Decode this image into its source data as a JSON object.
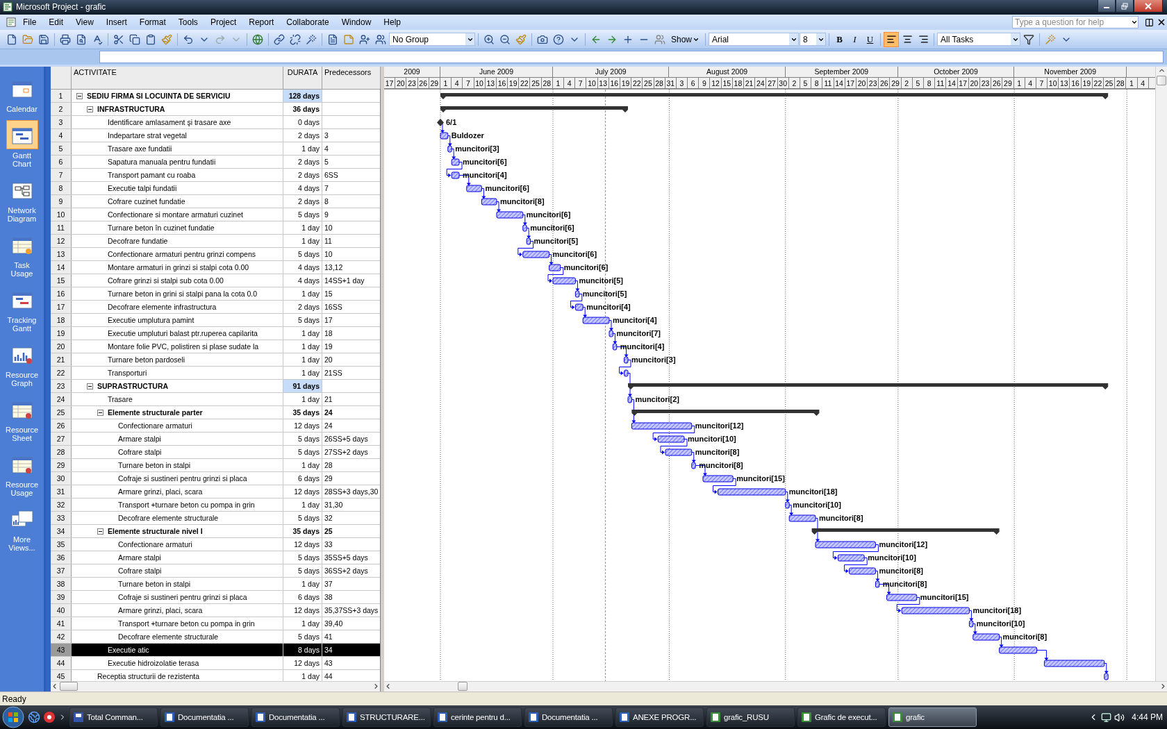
{
  "window": {
    "title": "Microsoft Project - grafic"
  },
  "menu": [
    "File",
    "Edit",
    "View",
    "Insert",
    "Format",
    "Tools",
    "Project",
    "Report",
    "Collaborate",
    "Window",
    "Help"
  ],
  "help_box": {
    "placeholder": "Type a question for help"
  },
  "toolbar": {
    "group": "No Group",
    "show": "Show",
    "font": "Arial",
    "size": "8",
    "format_buttons": [
      "B",
      "I",
      "U"
    ],
    "align": [
      {
        "kind": "left",
        "selected": true
      },
      {
        "kind": "center",
        "selected": false
      },
      {
        "kind": "right",
        "selected": false
      }
    ],
    "filter": "All Tasks"
  },
  "view_bar": [
    {
      "kind": "calendar",
      "label": "Calendar",
      "selected": false
    },
    {
      "kind": "gantt",
      "label": "Gantt Chart",
      "selected": true
    },
    {
      "kind": "network",
      "label": "Network Diagram",
      "selected": false
    },
    {
      "kind": "task_usage",
      "label": "Task Usage",
      "selected": false
    },
    {
      "kind": "tracking",
      "label": "Tracking Gantt",
      "selected": false
    },
    {
      "kind": "graph",
      "label": "Resource Graph",
      "selected": false
    },
    {
      "kind": "sheet",
      "label": "Resource Sheet",
      "selected": false
    },
    {
      "kind": "resource_usage",
      "label": "Resource Usage",
      "selected": false
    },
    {
      "kind": "more",
      "label": "More Views...",
      "selected": false
    }
  ],
  "table": {
    "columns": [
      "ACTIVITATE",
      "DURATA",
      "Predecessors"
    ],
    "tasks": [
      {
        "id": "1",
        "name": "SEDIU FIRMA SI LOCUINTA DE SERVICIU",
        "duration": "128 days",
        "kind": "summary",
        "expanded": true,
        "selected": false,
        "duration_highlighted": true,
        "children": [
          {
            "id": "2",
            "name": "INFRASTRUCTURA",
            "duration": "36 days",
            "kind": "summary",
            "expanded": true,
            "selected": false,
            "duration_highlighted": false,
            "children": [
              {
                "id": "3",
                "name": "Identificare amlasament şi trasare axe",
                "duration": "0 days",
                "kind": "milestone",
                "selected": false,
                "duration_highlighted": false,
                "bar_label": "6/1"
              },
              {
                "id": "4",
                "name": "Indepartare strat vegetal",
                "duration": "2 days",
                "predecessors": "3",
                "kind": "task",
                "selected": false,
                "duration_highlighted": false,
                "bar_label": "Buldozer"
              },
              {
                "id": "5",
                "name": "Trasare axe fundatii",
                "duration": "1 day",
                "predecessors": "4",
                "kind": "task",
                "selected": false,
                "duration_highlighted": false,
                "bar_label": "muncitori[3]"
              },
              {
                "id": "6",
                "name": "Sapatura manuala pentru fundatii",
                "duration": "2 days",
                "predecessors": "5",
                "kind": "task",
                "selected": false,
                "duration_highlighted": false,
                "bar_label": "muncitori[6]"
              },
              {
                "id": "7",
                "name": "Transport pamant cu roaba",
                "duration": "2 days",
                "predecessors": "6SS",
                "kind": "task",
                "selected": false,
                "duration_highlighted": false,
                "bar_label": "muncitori[4]"
              },
              {
                "id": "8",
                "name": "Executie talpi fundatii",
                "duration": "4 days",
                "predecessors": "7",
                "kind": "task",
                "selected": false,
                "duration_highlighted": false,
                "bar_label": "muncitori[6]"
              },
              {
                "id": "9",
                "name": "Cofrare cuzinet fundatie",
                "duration": "2 days",
                "predecessors": "8",
                "kind": "task",
                "selected": false,
                "duration_highlighted": false,
                "bar_label": "muncitori[8]"
              },
              {
                "id": "10",
                "name": "Confectionare si montare armaturi cuzinet",
                "duration": "5 days",
                "predecessors": "9",
                "kind": "task",
                "selected": false,
                "duration_highlighted": false,
                "bar_label": "muncitori[6]"
              },
              {
                "id": "11",
                "name": "Turnare beton în cuzinet fundatie",
                "duration": "1 day",
                "predecessors": "10",
                "kind": "task",
                "selected": false,
                "duration_highlighted": false,
                "bar_label": "muncitori[6]"
              },
              {
                "id": "12",
                "name": "Decofrare fundatie",
                "duration": "1 day",
                "predecessors": "11",
                "kind": "task",
                "selected": false,
                "duration_highlighted": false,
                "bar_label": "muncitori[5]"
              },
              {
                "id": "13",
                "name": "Confectionare armaturi pentru grinzi compens",
                "duration": "5 days",
                "predecessors": "10",
                "kind": "task",
                "selected": false,
                "duration_highlighted": false,
                "bar_label": "muncitori[6]"
              },
              {
                "id": "14",
                "name": "Montare armaturi in grinzi si stalpi cota 0.00",
                "duration": "4 days",
                "predecessors": "13,12",
                "kind": "task",
                "selected": false,
                "duration_highlighted": false,
                "bar_label": "muncitori[6]"
              },
              {
                "id": "15",
                "name": "Cofrare grinzi si stalpi sub cota 0.00",
                "duration": "4 days",
                "predecessors": "14SS+1 day",
                "kind": "task",
                "selected": false,
                "duration_highlighted": false,
                "bar_label": "muncitori[5]"
              },
              {
                "id": "16",
                "name": "Turnare beton in grini si stalpi pana la cota 0.0",
                "duration": "1 day",
                "predecessors": "15",
                "kind": "task",
                "selected": false,
                "duration_highlighted": false,
                "bar_label": "muncitori[5]"
              },
              {
                "id": "17",
                "name": "Decofrare elemente infrastructura",
                "duration": "2 days",
                "predecessors": "16SS",
                "kind": "task",
                "selected": false,
                "duration_highlighted": false,
                "bar_label": "muncitori[4]"
              },
              {
                "id": "18",
                "name": "Executie umplutura pamint",
                "duration": "5 days",
                "predecessors": "17",
                "kind": "task",
                "selected": false,
                "duration_highlighted": false,
                "bar_label": "muncitori[4]"
              },
              {
                "id": "19",
                "name": "Executie umpluturi balast ptr.ruperea capilarita",
                "duration": "1 day",
                "predecessors": "18",
                "kind": "task",
                "selected": false,
                "duration_highlighted": false,
                "bar_label": "muncitori[7]"
              },
              {
                "id": "20",
                "name": "Montare folie PVC, polistiren si plase sudate la",
                "duration": "1 day",
                "predecessors": "19",
                "kind": "task",
                "selected": false,
                "duration_highlighted": false,
                "bar_label": "muncitori[4]"
              },
              {
                "id": "21",
                "name": "Turnare beton pardoseli",
                "duration": "1 day",
                "predecessors": "20",
                "kind": "task",
                "selected": false,
                "duration_highlighted": false,
                "bar_label": "muncitori[3]"
              },
              {
                "id": "22",
                "name": "Transporturi",
                "duration": "1 day",
                "predecessors": "21SS",
                "kind": "task",
                "selected": false,
                "duration_highlighted": false
              }
            ]
          },
          {
            "id": "23",
            "name": "SUPRASTRUCTURA",
            "duration": "91 days",
            "kind": "summary",
            "expanded": true,
            "selected": false,
            "duration_highlighted": true,
            "children": [
              {
                "id": "24",
                "name": "Trasare",
                "duration": "1 day",
                "predecessors": "21",
                "kind": "task",
                "selected": false,
                "duration_highlighted": false,
                "bar_label": "muncitori[2]"
              },
              {
                "id": "25",
                "name": "Elemente structurale parter",
                "duration": "35 days",
                "predecessors": "24",
                "kind": "summary",
                "expanded": true,
                "selected": false,
                "duration_highlighted": false,
                "children": [
                  {
                    "id": "26",
                    "name": "Confectionare armaturi",
                    "duration": "12 days",
                    "predecessors": "24",
                    "kind": "task",
                    "selected": false,
                    "duration_highlighted": false,
                    "bar_label": "muncitori[12]"
                  },
                  {
                    "id": "27",
                    "name": "Armare stalpi",
                    "duration": "5 days",
                    "predecessors": "26SS+5 days",
                    "kind": "task",
                    "selected": false,
                    "duration_highlighted": false,
                    "bar_label": "muncitori[10]"
                  },
                  {
                    "id": "28",
                    "name": "Cofrare stalpi",
                    "duration": "5 days",
                    "predecessors": "27SS+2 days",
                    "kind": "task",
                    "selected": false,
                    "duration_highlighted": false,
                    "bar_label": "muncitori[8]"
                  },
                  {
                    "id": "29",
                    "name": "Turnare beton in stalpi",
                    "duration": "1 day",
                    "predecessors": "28",
                    "kind": "task",
                    "selected": false,
                    "duration_highlighted": false,
                    "bar_label": "muncitori[8]"
                  },
                  {
                    "id": "30",
                    "name": "Cofraje si sustineri pentru grinzi si placa",
                    "duration": "6 days",
                    "predecessors": "29",
                    "kind": "task",
                    "selected": false,
                    "duration_highlighted": false,
                    "bar_label": "muncitori[15]"
                  },
                  {
                    "id": "31",
                    "name": "Armare grinzi, placi, scara",
                    "duration": "12 days",
                    "predecessors": "28SS+3 days,30",
                    "kind": "task",
                    "selected": false,
                    "duration_highlighted": false,
                    "bar_label": "muncitori[18]"
                  },
                  {
                    "id": "32",
                    "name": "Transport +turnare beton cu pompa in grin",
                    "duration": "1 day",
                    "predecessors": "31,30",
                    "kind": "task",
                    "selected": false,
                    "duration_highlighted": false,
                    "bar_label": "muncitori[10]"
                  },
                  {
                    "id": "33",
                    "name": "Decofrare elemente structurale",
                    "duration": "5 days",
                    "predecessors": "32",
                    "kind": "task",
                    "selected": false,
                    "duration_highlighted": false,
                    "bar_label": "muncitori[8]"
                  }
                ]
              },
              {
                "id": "34",
                "name": "Elemente structurale nivel I",
                "duration": "35 days",
                "predecessors": "25",
                "kind": "summary",
                "expanded": true,
                "selected": false,
                "duration_highlighted": false,
                "children": [
                  {
                    "id": "35",
                    "name": "Confectionare armaturi",
                    "duration": "12 days",
                    "predecessors": "33",
                    "kind": "task",
                    "selected": false,
                    "duration_highlighted": false,
                    "bar_label": "muncitori[12]"
                  },
                  {
                    "id": "36",
                    "name": "Armare stalpi",
                    "duration": "5 days",
                    "predecessors": "35SS+5 days",
                    "kind": "task",
                    "selected": false,
                    "duration_highlighted": false,
                    "bar_label": "muncitori[10]"
                  },
                  {
                    "id": "37",
                    "name": "Cofrare stalpi",
                    "duration": "5 days",
                    "predecessors": "36SS+2 days",
                    "kind": "task",
                    "selected": false,
                    "duration_highlighted": false,
                    "bar_label": "muncitori[8]"
                  },
                  {
                    "id": "38",
                    "name": "Turnare beton in stalpi",
                    "duration": "1 day",
                    "predecessors": "37",
                    "kind": "task",
                    "selected": false,
                    "duration_highlighted": false,
                    "bar_label": "muncitori[8]"
                  },
                  {
                    "id": "39",
                    "name": "Cofraje si sustineri pentru grinzi si placa",
                    "duration": "6 days",
                    "predecessors": "38",
                    "kind": "task",
                    "selected": false,
                    "duration_highlighted": false,
                    "bar_label": "muncitori[15]"
                  },
                  {
                    "id": "40",
                    "name": "Armare grinzi, placi, scara",
                    "duration": "12 days",
                    "predecessors": "35,37SS+3 days",
                    "kind": "task",
                    "selected": false,
                    "duration_highlighted": false,
                    "bar_label": "muncitori[18]"
                  },
                  {
                    "id": "41",
                    "name": "Transport +turnare beton cu pompa in grin",
                    "duration": "1 day",
                    "predecessors": "39,40",
                    "kind": "task",
                    "selected": false,
                    "duration_highlighted": false,
                    "bar_label": "muncitori[10]"
                  },
                  {
                    "id": "42",
                    "name": "Decofrare elemente structurale",
                    "duration": "5 days",
                    "predecessors": "41",
                    "kind": "task",
                    "selected": false,
                    "duration_highlighted": false,
                    "bar_label": "muncitori[8]"
                  }
                ]
              },
              {
                "id": "43",
                "name": "Executie atic",
                "duration": "8 days",
                "predecessors": "34",
                "kind": "task",
                "selected": true,
                "duration_highlighted": false
              },
              {
                "id": "44",
                "name": "Executie hidroizolatie terasa",
                "duration": "12 days",
                "predecessors": "43",
                "kind": "task",
                "selected": false,
                "duration_highlighted": false
              }
            ]
          },
          {
            "id": "45",
            "name": "Receptia structurii de rezistenta",
            "duration": "1 day",
            "predecessors": "44",
            "kind": "task",
            "selected": false,
            "duration_highlighted": false
          }
        ]
      }
    ]
  },
  "gantt": {
    "months": [
      "2009",
      "June 2009",
      "July 2009",
      "August 2009",
      "September 2009",
      "October 2009",
      "November 2009"
    ],
    "day_labels": [
      "17",
      "20",
      "23",
      "26",
      "29",
      "1",
      "4",
      "7",
      "10",
      "13",
      "16",
      "19",
      "22",
      "25",
      "28",
      "1",
      "4",
      "7",
      "10",
      "13",
      "16",
      "19",
      "22",
      "25",
      "28",
      "31",
      "3",
      "6",
      "9",
      "12",
      "15",
      "18",
      "21",
      "24",
      "27",
      "30",
      "2",
      "5",
      "8",
      "11",
      "14",
      "17",
      "20",
      "23",
      "26",
      "29",
      "2",
      "5",
      "8",
      "11",
      "14",
      "17",
      "20",
      "23",
      "26",
      "29",
      "1",
      "4",
      "7",
      "10",
      "13",
      "16",
      "19",
      "22",
      "25",
      "28",
      "1",
      "4"
    ]
  },
  "status_bar": "Ready",
  "taskbar": {
    "items": [
      {
        "label": "Total Comman...",
        "kind": "disk",
        "selected": false
      },
      {
        "label": "Documentatia ...",
        "kind": "word",
        "selected": false
      },
      {
        "label": "Documentatia ...",
        "kind": "word",
        "selected": false
      },
      {
        "label": "STRUCTURARE...",
        "kind": "word",
        "selected": false
      },
      {
        "label": "cerinte pentru d...",
        "kind": "word",
        "selected": false
      },
      {
        "label": "Documentatia ...",
        "kind": "word",
        "selected": false
      },
      {
        "label": "ANEXE PROGR...",
        "kind": "word",
        "selected": false
      },
      {
        "label": "grafic_RUSU",
        "kind": "project",
        "selected": false
      },
      {
        "label": "Grafic de execut...",
        "kind": "project",
        "selected": false
      },
      {
        "label": "grafic",
        "kind": "project",
        "selected": true
      }
    ],
    "clock": "4:44 PM"
  }
}
